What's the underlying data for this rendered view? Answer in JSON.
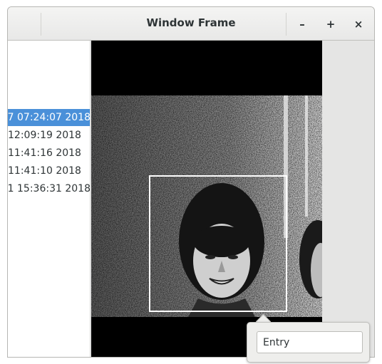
{
  "window": {
    "title": "Window Frame",
    "minimize_label": "–",
    "maximize_label": "+",
    "close_label": "×"
  },
  "list": {
    "items": [
      {
        "label": "7 07:24:07 2018",
        "selected": true
      },
      {
        "label": "12:09:19 2018",
        "selected": false
      },
      {
        "label": "11:41:16 2018",
        "selected": false
      },
      {
        "label": "11:41:10 2018",
        "selected": false
      },
      {
        "label": "1 15:36:31 2018",
        "selected": false
      }
    ]
  },
  "viewer": {
    "image": "grayscale-photo-of-person-smiling",
    "face_box_color": "#ffffff"
  },
  "popover": {
    "entry_value": "Entry"
  },
  "colors": {
    "selection": "#4a90d9",
    "titlebar": "#ebebea",
    "viewer_background": "#000000"
  }
}
